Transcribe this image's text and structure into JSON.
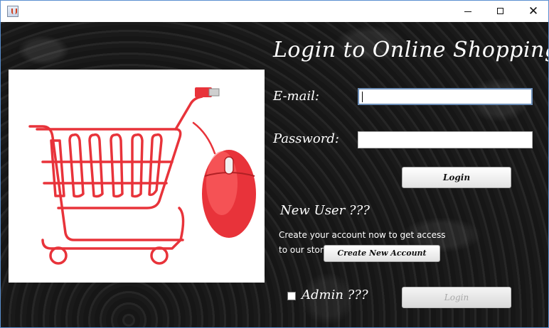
{
  "window": {
    "title": "",
    "minimize_label": "",
    "close_label": "✕"
  },
  "header": {
    "title": "Login to Online Shopping..."
  },
  "form": {
    "email_label": "E-mail:",
    "email_value": "",
    "password_label": "Password:",
    "password_value": "",
    "login_label": "Login"
  },
  "new_user": {
    "heading": "New User ???",
    "info": "Create your account now to get access to our store.",
    "create_label": "Create New Account"
  },
  "admin": {
    "checkbox_label": "Admin ???",
    "checked": false,
    "login_label": "Login"
  },
  "image": {
    "subject": "shopping-cart-with-mouse"
  },
  "colors": {
    "cart_red": "#e8333a",
    "background": "#141414",
    "text": "#ffffff"
  }
}
